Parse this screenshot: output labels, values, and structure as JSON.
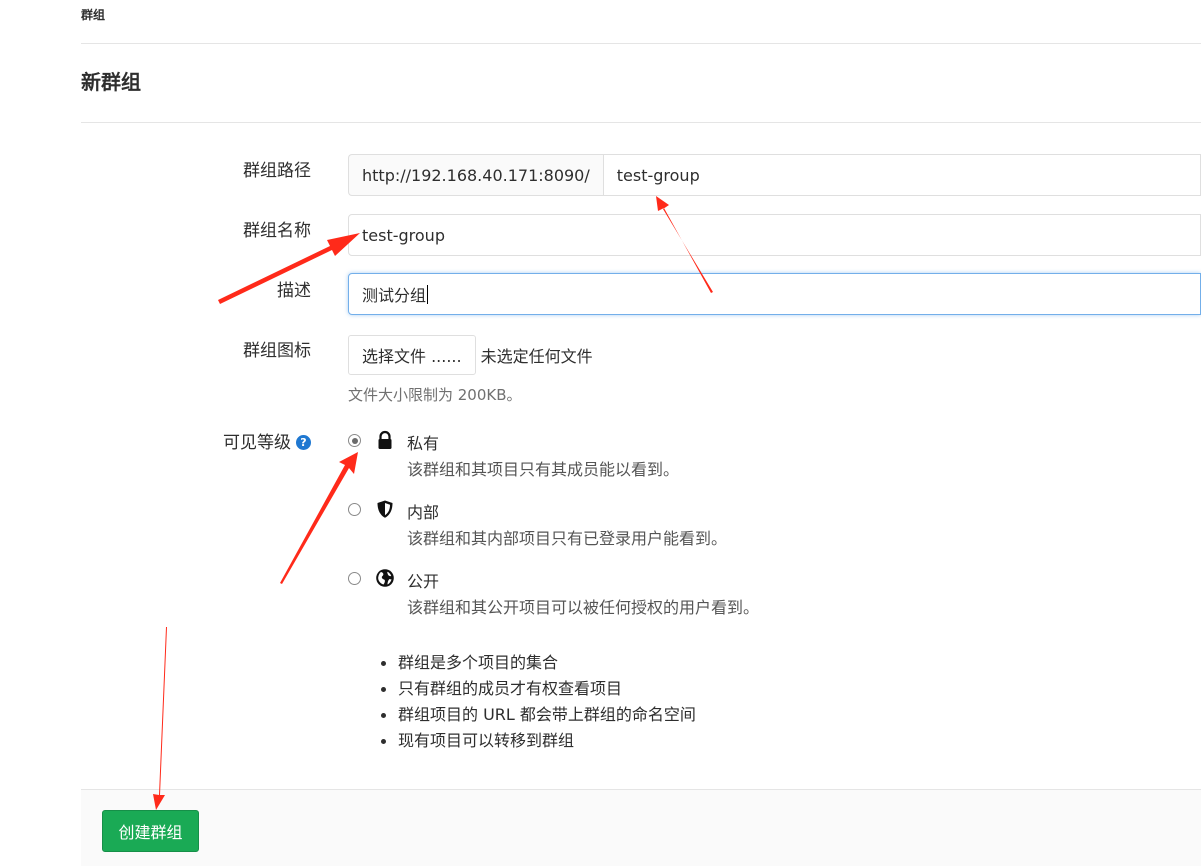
{
  "breadcrumb": "群组",
  "page_title": "新群组",
  "form": {
    "path": {
      "label": "群组路径",
      "prefix": "http://192.168.40.171:8090/",
      "value": "test-group"
    },
    "name": {
      "label": "群组名称",
      "value": "test-group"
    },
    "description": {
      "label": "描述",
      "value": "测试分组"
    },
    "avatar": {
      "label": "群组图标",
      "button_label": "选择文件 ......",
      "status": "未选定任何文件",
      "help": "文件大小限制为 200KB。"
    },
    "visibility": {
      "label": "可见等级",
      "help_icon": "question-circle-icon",
      "selected": "private",
      "options": [
        {
          "key": "private",
          "icon": "lock-icon",
          "title": "私有",
          "description": "该群组和其项目只有其成员能以看到。"
        },
        {
          "key": "internal",
          "icon": "shield-icon",
          "title": "内部",
          "description": "该群组和其内部项目只有已登录用户能看到。"
        },
        {
          "key": "public",
          "icon": "globe-icon",
          "title": "公开",
          "description": "该群组和其公开项目可以被任何授权的用户看到。"
        }
      ]
    }
  },
  "info_list": [
    "群组是多个项目的集合",
    "只有群组的成员才有权查看项目",
    "群组项目的 URL 都会带上群组的命名空间",
    "现有项目可以转移到群组"
  ],
  "submit_label": "创建群组",
  "colors": {
    "primary_green": "#1aaa55",
    "focus_blue": "#73afea",
    "help_blue": "#1f78d1",
    "annotation_red": "#ff2a1a"
  }
}
